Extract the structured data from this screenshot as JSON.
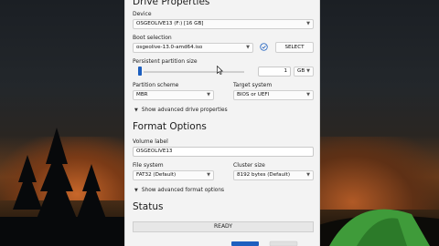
{
  "drive_properties": {
    "title": "Drive Properties",
    "device_label": "Device",
    "device_value": "OSGEOLIVE13 (F:) [16 GB]",
    "boot_selection_label": "Boot selection",
    "boot_selection_value": "osgeolive-13.0-amd64.iso",
    "select_button": "SELECT",
    "persistent_label": "Persistent partition size",
    "persistent_value": "1",
    "persistent_unit": "GB",
    "partition_scheme_label": "Partition scheme",
    "partition_scheme_value": "MBR",
    "target_system_label": "Target system",
    "target_system_value": "BIOS or UEFI",
    "advanced_drive": "Show advanced drive properties"
  },
  "format_options": {
    "title": "Format Options",
    "volume_label_label": "Volume label",
    "volume_label_value": "OSGEOLIVE13",
    "file_system_label": "File system",
    "file_system_value": "FAT32 (Default)",
    "cluster_size_label": "Cluster size",
    "cluster_size_value": "8192 bytes (Default)",
    "advanced_format": "Show advanced format options"
  },
  "status": {
    "title": "Status",
    "value": "READY"
  },
  "colors": {
    "accent": "#1d5fbf",
    "dialog_bg": "#f3f3f3"
  },
  "icons": {
    "check": "check-circle-icon",
    "dropdown": "chevron-down-icon",
    "expand": "chevron-down-icon"
  }
}
